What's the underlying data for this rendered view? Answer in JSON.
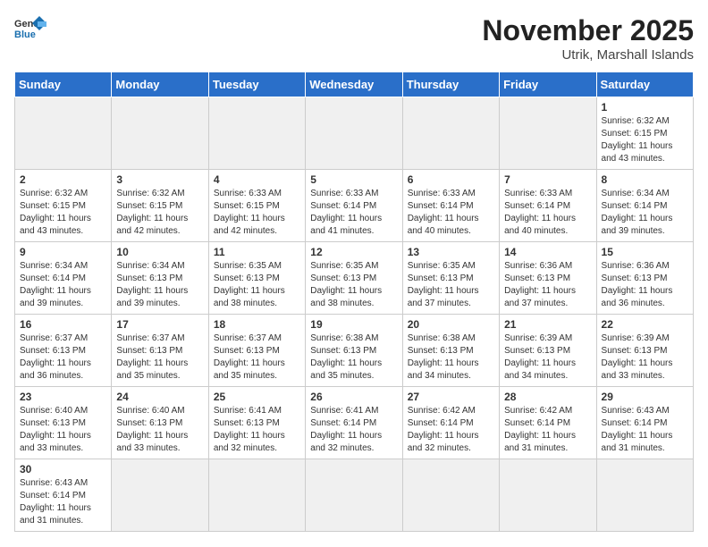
{
  "logo": {
    "text_general": "General",
    "text_blue": "Blue"
  },
  "title": "November 2025",
  "subtitle": "Utrik, Marshall Islands",
  "days_of_week": [
    "Sunday",
    "Monday",
    "Tuesday",
    "Wednesday",
    "Thursday",
    "Friday",
    "Saturday"
  ],
  "weeks": [
    [
      {
        "day": "",
        "info": "",
        "empty": true
      },
      {
        "day": "",
        "info": "",
        "empty": true
      },
      {
        "day": "",
        "info": "",
        "empty": true
      },
      {
        "day": "",
        "info": "",
        "empty": true
      },
      {
        "day": "",
        "info": "",
        "empty": true
      },
      {
        "day": "",
        "info": "",
        "empty": true
      },
      {
        "day": "1",
        "info": "Sunrise: 6:32 AM\nSunset: 6:15 PM\nDaylight: 11 hours\nand 43 minutes."
      }
    ],
    [
      {
        "day": "2",
        "info": "Sunrise: 6:32 AM\nSunset: 6:15 PM\nDaylight: 11 hours\nand 43 minutes."
      },
      {
        "day": "3",
        "info": "Sunrise: 6:32 AM\nSunset: 6:15 PM\nDaylight: 11 hours\nand 42 minutes."
      },
      {
        "day": "4",
        "info": "Sunrise: 6:33 AM\nSunset: 6:15 PM\nDaylight: 11 hours\nand 42 minutes."
      },
      {
        "day": "5",
        "info": "Sunrise: 6:33 AM\nSunset: 6:14 PM\nDaylight: 11 hours\nand 41 minutes."
      },
      {
        "day": "6",
        "info": "Sunrise: 6:33 AM\nSunset: 6:14 PM\nDaylight: 11 hours\nand 40 minutes."
      },
      {
        "day": "7",
        "info": "Sunrise: 6:33 AM\nSunset: 6:14 PM\nDaylight: 11 hours\nand 40 minutes."
      },
      {
        "day": "8",
        "info": "Sunrise: 6:34 AM\nSunset: 6:14 PM\nDaylight: 11 hours\nand 39 minutes."
      }
    ],
    [
      {
        "day": "9",
        "info": "Sunrise: 6:34 AM\nSunset: 6:14 PM\nDaylight: 11 hours\nand 39 minutes."
      },
      {
        "day": "10",
        "info": "Sunrise: 6:34 AM\nSunset: 6:13 PM\nDaylight: 11 hours\nand 39 minutes."
      },
      {
        "day": "11",
        "info": "Sunrise: 6:35 AM\nSunset: 6:13 PM\nDaylight: 11 hours\nand 38 minutes."
      },
      {
        "day": "12",
        "info": "Sunrise: 6:35 AM\nSunset: 6:13 PM\nDaylight: 11 hours\nand 38 minutes."
      },
      {
        "day": "13",
        "info": "Sunrise: 6:35 AM\nSunset: 6:13 PM\nDaylight: 11 hours\nand 37 minutes."
      },
      {
        "day": "14",
        "info": "Sunrise: 6:36 AM\nSunset: 6:13 PM\nDaylight: 11 hours\nand 37 minutes."
      },
      {
        "day": "15",
        "info": "Sunrise: 6:36 AM\nSunset: 6:13 PM\nDaylight: 11 hours\nand 36 minutes."
      }
    ],
    [
      {
        "day": "16",
        "info": "Sunrise: 6:37 AM\nSunset: 6:13 PM\nDaylight: 11 hours\nand 36 minutes."
      },
      {
        "day": "17",
        "info": "Sunrise: 6:37 AM\nSunset: 6:13 PM\nDaylight: 11 hours\nand 35 minutes."
      },
      {
        "day": "18",
        "info": "Sunrise: 6:37 AM\nSunset: 6:13 PM\nDaylight: 11 hours\nand 35 minutes."
      },
      {
        "day": "19",
        "info": "Sunrise: 6:38 AM\nSunset: 6:13 PM\nDaylight: 11 hours\nand 35 minutes."
      },
      {
        "day": "20",
        "info": "Sunrise: 6:38 AM\nSunset: 6:13 PM\nDaylight: 11 hours\nand 34 minutes."
      },
      {
        "day": "21",
        "info": "Sunrise: 6:39 AM\nSunset: 6:13 PM\nDaylight: 11 hours\nand 34 minutes."
      },
      {
        "day": "22",
        "info": "Sunrise: 6:39 AM\nSunset: 6:13 PM\nDaylight: 11 hours\nand 33 minutes."
      }
    ],
    [
      {
        "day": "23",
        "info": "Sunrise: 6:40 AM\nSunset: 6:13 PM\nDaylight: 11 hours\nand 33 minutes."
      },
      {
        "day": "24",
        "info": "Sunrise: 6:40 AM\nSunset: 6:13 PM\nDaylight: 11 hours\nand 33 minutes."
      },
      {
        "day": "25",
        "info": "Sunrise: 6:41 AM\nSunset: 6:13 PM\nDaylight: 11 hours\nand 32 minutes."
      },
      {
        "day": "26",
        "info": "Sunrise: 6:41 AM\nSunset: 6:14 PM\nDaylight: 11 hours\nand 32 minutes."
      },
      {
        "day": "27",
        "info": "Sunrise: 6:42 AM\nSunset: 6:14 PM\nDaylight: 11 hours\nand 32 minutes."
      },
      {
        "day": "28",
        "info": "Sunrise: 6:42 AM\nSunset: 6:14 PM\nDaylight: 11 hours\nand 31 minutes."
      },
      {
        "day": "29",
        "info": "Sunrise: 6:43 AM\nSunset: 6:14 PM\nDaylight: 11 hours\nand 31 minutes."
      }
    ],
    [
      {
        "day": "30",
        "info": "Sunrise: 6:43 AM\nSunset: 6:14 PM\nDaylight: 11 hours\nand 31 minutes."
      },
      {
        "day": "",
        "info": "",
        "empty": true
      },
      {
        "day": "",
        "info": "",
        "empty": true
      },
      {
        "day": "",
        "info": "",
        "empty": true
      },
      {
        "day": "",
        "info": "",
        "empty": true
      },
      {
        "day": "",
        "info": "",
        "empty": true
      },
      {
        "day": "",
        "info": "",
        "empty": true
      }
    ]
  ]
}
